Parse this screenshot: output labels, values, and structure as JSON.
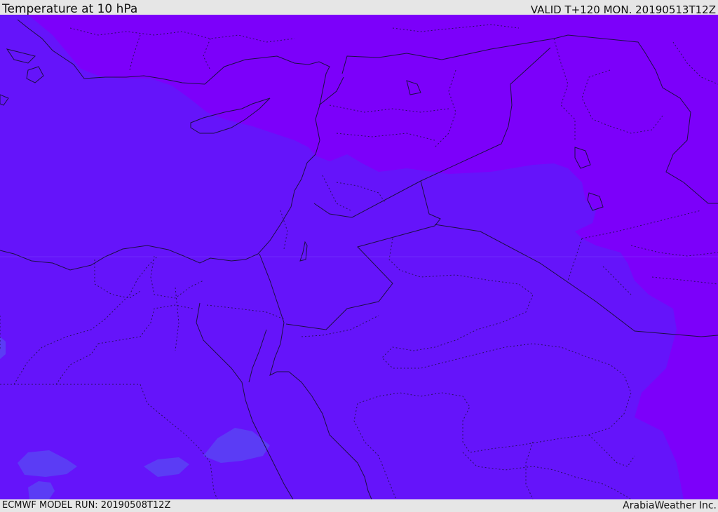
{
  "header": {
    "title": "Temperature at 10 hPa",
    "valid_label": "VALID T+120 MON. 20190513T12Z"
  },
  "footer": {
    "model_run": "ECMWF MODEL RUN: 20190508T12Z",
    "credit": "ArabiaWeather Inc."
  },
  "map": {
    "fill_colors": {
      "base": "#6514fa",
      "warm_zone": "#7c00fa",
      "cool_patches": "#5b3cf5"
    }
  }
}
